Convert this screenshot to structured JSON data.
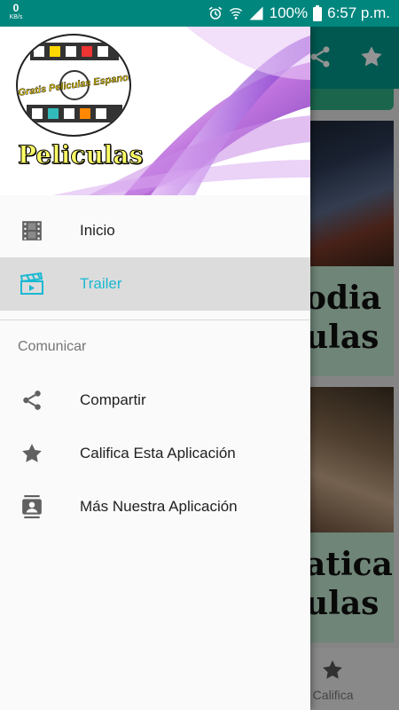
{
  "status_bar": {
    "network_speed_value": "0",
    "network_speed_unit": "KB/s",
    "battery": "100%",
    "time": "6:57 p.m."
  },
  "drawer": {
    "logo_text": "Gratis Peliculas Espanol",
    "header_title": "Peliculas",
    "items": [
      {
        "label": "Inicio",
        "icon": "film-icon"
      },
      {
        "label": "Trailer",
        "icon": "clapperboard-icon"
      }
    ],
    "section_title": "Comunicar",
    "section_items": [
      {
        "label": "Compartir",
        "icon": "share-icon"
      },
      {
        "label": "Califica Esta Aplicación",
        "icon": "star-icon"
      },
      {
        "label": "Más Nuestra Aplicación",
        "icon": "contact-card-icon"
      }
    ]
  },
  "background": {
    "card_1_title_lines": [
      "odia",
      "ulas"
    ],
    "card_2_title_lines": [
      "aticas",
      "ulas"
    ],
    "bottom_nav_label": "os Califica"
  },
  "colors": {
    "accent": "#00988c",
    "status_bar": "#00867d",
    "active_item_text": "#1ab9d2",
    "active_item_bg": "#dcdcdc"
  }
}
